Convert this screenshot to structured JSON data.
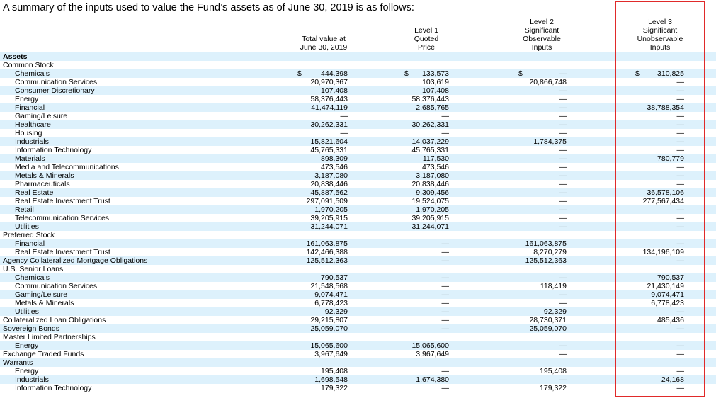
{
  "title": "A summary of the inputs used to value the Fund’s assets as of June 30, 2019 is as follows:",
  "headers": {
    "total": [
      "Total value at",
      "June 30, 2019"
    ],
    "level1": [
      "Level 1",
      "Quoted",
      "Price"
    ],
    "level2": [
      "Level 2",
      "Significant",
      "Observable",
      "Inputs"
    ],
    "level3": [
      "Level 3",
      "Significant",
      "Unobservable",
      "Inputs"
    ]
  },
  "dollar_sign": "$",
  "rows": [
    {
      "label": "Assets",
      "indent": false,
      "bold": true,
      "total": "",
      "l1": "",
      "l2": "",
      "l3": "",
      "dollar": false
    },
    {
      "label": "Common Stock",
      "indent": false,
      "bold": false,
      "total": "",
      "l1": "",
      "l2": "",
      "l3": "",
      "dollar": false
    },
    {
      "label": "Chemicals",
      "indent": true,
      "bold": false,
      "total": "444,398",
      "l1": "133,573",
      "l2": "—",
      "l3": "310,825",
      "dollar": true
    },
    {
      "label": "Communication Services",
      "indent": true,
      "bold": false,
      "total": "20,970,367",
      "l1": "103,619",
      "l2": "20,866,748",
      "l3": "—",
      "dollar": false
    },
    {
      "label": "Consumer Discretionary",
      "indent": true,
      "bold": false,
      "total": "107,408",
      "l1": "107,408",
      "l2": "—",
      "l3": "—",
      "dollar": false
    },
    {
      "label": "Energy",
      "indent": true,
      "bold": false,
      "total": "58,376,443",
      "l1": "58,376,443",
      "l2": "—",
      "l3": "—",
      "dollar": false
    },
    {
      "label": "Financial",
      "indent": true,
      "bold": false,
      "total": "41,474,119",
      "l1": "2,685,765",
      "l2": "—",
      "l3": "38,788,354",
      "dollar": false
    },
    {
      "label": "Gaming/Leisure",
      "indent": true,
      "bold": false,
      "total": "—",
      "l1": "—",
      "l2": "—",
      "l3": "—",
      "dollar": false
    },
    {
      "label": "Healthcare",
      "indent": true,
      "bold": false,
      "total": "30,262,331",
      "l1": "30,262,331",
      "l2": "—",
      "l3": "—",
      "dollar": false
    },
    {
      "label": "Housing",
      "indent": true,
      "bold": false,
      "total": "—",
      "l1": "—",
      "l2": "—",
      "l3": "—",
      "dollar": false
    },
    {
      "label": "Industrials",
      "indent": true,
      "bold": false,
      "total": "15,821,604",
      "l1": "14,037,229",
      "l2": "1,784,375",
      "l3": "—",
      "dollar": false
    },
    {
      "label": "Information Technology",
      "indent": true,
      "bold": false,
      "total": "45,765,331",
      "l1": "45,765,331",
      "l2": "—",
      "l3": "—",
      "dollar": false
    },
    {
      "label": "Materials",
      "indent": true,
      "bold": false,
      "total": "898,309",
      "l1": "117,530",
      "l2": "—",
      "l3": "780,779",
      "dollar": false
    },
    {
      "label": "Media and Telecommunications",
      "indent": true,
      "bold": false,
      "total": "473,546",
      "l1": "473,546",
      "l2": "—",
      "l3": "—",
      "dollar": false
    },
    {
      "label": "Metals & Minerals",
      "indent": true,
      "bold": false,
      "total": "3,187,080",
      "l1": "3,187,080",
      "l2": "—",
      "l3": "—",
      "dollar": false
    },
    {
      "label": "Pharmaceuticals",
      "indent": true,
      "bold": false,
      "total": "20,838,446",
      "l1": "20,838,446",
      "l2": "—",
      "l3": "—",
      "dollar": false
    },
    {
      "label": "Real Estate",
      "indent": true,
      "bold": false,
      "total": "45,887,562",
      "l1": "9,309,456",
      "l2": "—",
      "l3": "36,578,106",
      "dollar": false
    },
    {
      "label": "Real Estate Investment Trust",
      "indent": true,
      "bold": false,
      "total": "297,091,509",
      "l1": "19,524,075",
      "l2": "—",
      "l3": "277,567,434",
      "dollar": false
    },
    {
      "label": "Retail",
      "indent": true,
      "bold": false,
      "total": "1,970,205",
      "l1": "1,970,205",
      "l2": "—",
      "l3": "—",
      "dollar": false
    },
    {
      "label": "Telecommunication Services",
      "indent": true,
      "bold": false,
      "total": "39,205,915",
      "l1": "39,205,915",
      "l2": "—",
      "l3": "—",
      "dollar": false
    },
    {
      "label": "Utilities",
      "indent": true,
      "bold": false,
      "total": "31,244,071",
      "l1": "31,244,071",
      "l2": "—",
      "l3": "—",
      "dollar": false
    },
    {
      "label": "Preferred Stock",
      "indent": false,
      "bold": false,
      "total": "",
      "l1": "",
      "l2": "",
      "l3": "",
      "dollar": false
    },
    {
      "label": "Financial",
      "indent": true,
      "bold": false,
      "total": "161,063,875",
      "l1": "—",
      "l2": "161,063,875",
      "l3": "—",
      "dollar": false
    },
    {
      "label": "Real Estate Investment Trust",
      "indent": true,
      "bold": false,
      "total": "142,466,388",
      "l1": "—",
      "l2": "8,270,279",
      "l3": "134,196,109",
      "dollar": false
    },
    {
      "label": "Agency Collateralized Mortgage Obligations",
      "indent": false,
      "bold": false,
      "total": "125,512,363",
      "l1": "—",
      "l2": "125,512,363",
      "l3": "—",
      "dollar": false
    },
    {
      "label": "U.S. Senior Loans",
      "indent": false,
      "bold": false,
      "total": "",
      "l1": "",
      "l2": "",
      "l3": "",
      "dollar": false
    },
    {
      "label": "Chemicals",
      "indent": true,
      "bold": false,
      "total": "790,537",
      "l1": "—",
      "l2": "—",
      "l3": "790,537",
      "dollar": false
    },
    {
      "label": "Communication Services",
      "indent": true,
      "bold": false,
      "total": "21,548,568",
      "l1": "—",
      "l2": "118,419",
      "l3": "21,430,149",
      "dollar": false
    },
    {
      "label": "Gaming/Leisure",
      "indent": true,
      "bold": false,
      "total": "9,074,471",
      "l1": "—",
      "l2": "—",
      "l3": "9,074,471",
      "dollar": false
    },
    {
      "label": "Metals & Minerals",
      "indent": true,
      "bold": false,
      "total": "6,778,423",
      "l1": "—",
      "l2": "—",
      "l3": "6,778,423",
      "dollar": false
    },
    {
      "label": "Utilities",
      "indent": true,
      "bold": false,
      "total": "92,329",
      "l1": "—",
      "l2": "92,329",
      "l3": "—",
      "dollar": false
    },
    {
      "label": "Collateralized Loan Obligations",
      "indent": false,
      "bold": false,
      "total": "29,215,807",
      "l1": "—",
      "l2": "28,730,371",
      "l3": "485,436",
      "dollar": false
    },
    {
      "label": "Sovereign Bonds",
      "indent": false,
      "bold": false,
      "total": "25,059,070",
      "l1": "—",
      "l2": "25,059,070",
      "l3": "—",
      "dollar": false
    },
    {
      "label": "Master Limited Partnerships",
      "indent": false,
      "bold": false,
      "total": "",
      "l1": "",
      "l2": "",
      "l3": "",
      "dollar": false
    },
    {
      "label": "Energy",
      "indent": true,
      "bold": false,
      "total": "15,065,600",
      "l1": "15,065,600",
      "l2": "—",
      "l3": "—",
      "dollar": false
    },
    {
      "label": "Exchange Traded Funds",
      "indent": false,
      "bold": false,
      "total": "3,967,649",
      "l1": "3,967,649",
      "l2": "—",
      "l3": "—",
      "dollar": false
    },
    {
      "label": "Warrants",
      "indent": false,
      "bold": false,
      "total": "",
      "l1": "",
      "l2": "",
      "l3": "",
      "dollar": false
    },
    {
      "label": "Energy",
      "indent": true,
      "bold": false,
      "total": "195,408",
      "l1": "—",
      "l2": "195,408",
      "l3": "—",
      "dollar": false
    },
    {
      "label": "Industrials",
      "indent": true,
      "bold": false,
      "total": "1,698,548",
      "l1": "1,674,380",
      "l2": "—",
      "l3": "24,168",
      "dollar": false
    },
    {
      "label": "Information Technology",
      "indent": true,
      "bold": false,
      "total": "179,322",
      "l1": "—",
      "l2": "179,322",
      "l3": "—",
      "dollar": false
    }
  ],
  "colors": {
    "row_shade": "#ddf1fc",
    "highlight_border": "#e02a2a"
  }
}
